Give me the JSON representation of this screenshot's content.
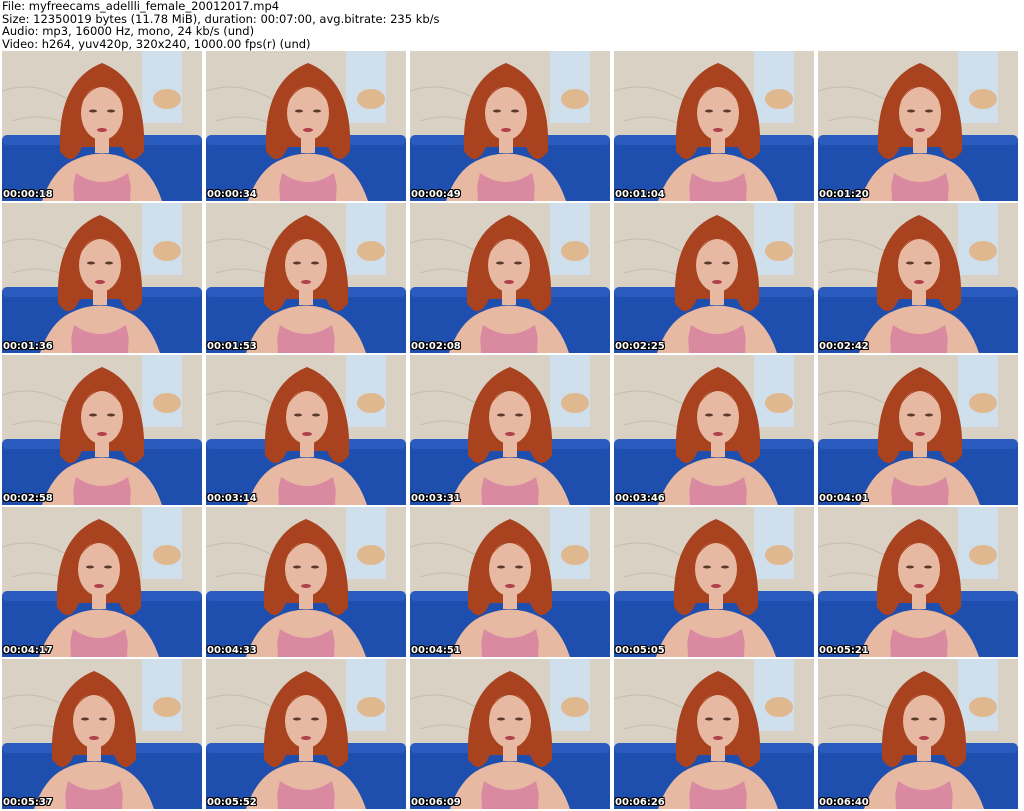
{
  "header": {
    "file_line": "File: myfreecams_adellli_female_20012017.mp4",
    "size_line": "Size: 12350019 bytes (11.78 MiB), duration: 00:07:00, avg.bitrate: 235 kb/s",
    "audio_line": "Audio: mp3, 16000 Hz, mono, 24 kb/s (und)",
    "video_line": "Video: h264, yuv420p, 320x240, 1000.00 fps(r) (und)"
  },
  "colors": {
    "wall": "#d9d2c4",
    "sofa": "#1f4fae",
    "hair": "#a8421f",
    "skin": "#e7b8a2",
    "top": "#d98aa0",
    "poster": "#cfe0ec"
  },
  "frames": [
    {
      "timestamp": "00:00:18"
    },
    {
      "timestamp": "00:00:34"
    },
    {
      "timestamp": "00:00:49"
    },
    {
      "timestamp": "00:01:04"
    },
    {
      "timestamp": "00:01:20"
    },
    {
      "timestamp": "00:01:36"
    },
    {
      "timestamp": "00:01:53"
    },
    {
      "timestamp": "00:02:08"
    },
    {
      "timestamp": "00:02:25"
    },
    {
      "timestamp": "00:02:42"
    },
    {
      "timestamp": "00:02:58"
    },
    {
      "timestamp": "00:03:14"
    },
    {
      "timestamp": "00:03:31"
    },
    {
      "timestamp": "00:03:46"
    },
    {
      "timestamp": "00:04:01"
    },
    {
      "timestamp": "00:04:17"
    },
    {
      "timestamp": "00:04:33"
    },
    {
      "timestamp": "00:04:51"
    },
    {
      "timestamp": "00:05:05"
    },
    {
      "timestamp": "00:05:21"
    },
    {
      "timestamp": "00:05:37"
    },
    {
      "timestamp": "00:05:52"
    },
    {
      "timestamp": "00:06:09"
    },
    {
      "timestamp": "00:06:26"
    },
    {
      "timestamp": "00:06:40"
    }
  ]
}
